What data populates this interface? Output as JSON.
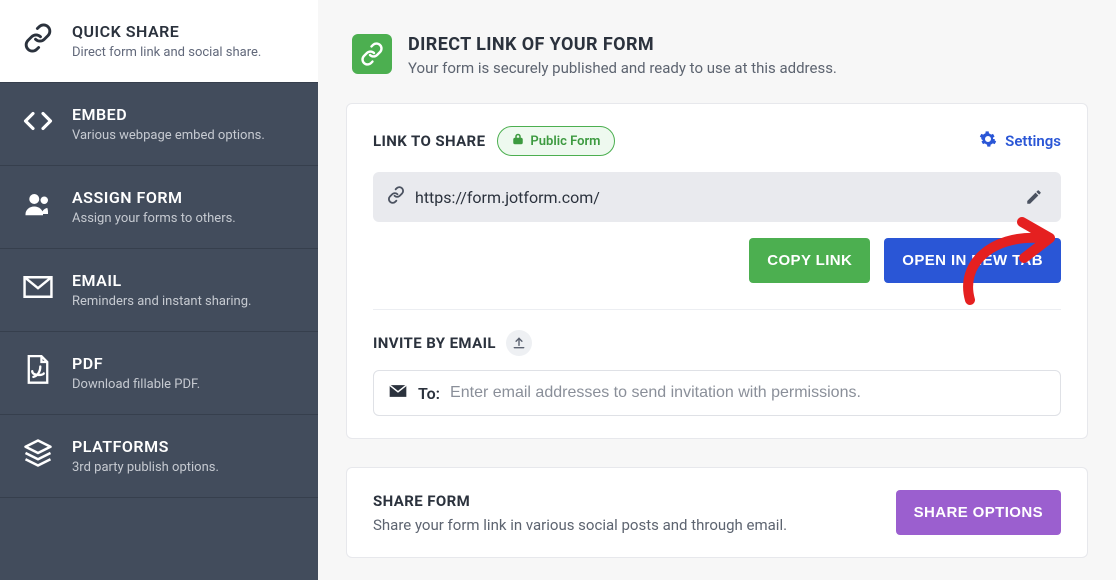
{
  "sidebar": {
    "items": [
      {
        "title": "QUICK SHARE",
        "sub": "Direct form link and social share.",
        "active": true
      },
      {
        "title": "EMBED",
        "sub": "Various webpage embed options."
      },
      {
        "title": "ASSIGN FORM",
        "sub": "Assign your forms to others."
      },
      {
        "title": "EMAIL",
        "sub": "Reminders and instant sharing."
      },
      {
        "title": "PDF",
        "sub": "Download fillable PDF."
      },
      {
        "title": "PLATFORMS",
        "sub": "3rd party publish options."
      }
    ]
  },
  "header": {
    "title": "DIRECT LINK OF YOUR FORM",
    "sub": "Your form is securely published and ready to use at this address."
  },
  "link_section": {
    "label": "LINK TO SHARE",
    "pill": "Public Form",
    "settings": "Settings",
    "url": "https://form.jotform.com/",
    "copy_btn": "COPY LINK",
    "open_btn": "OPEN IN NEW TAB"
  },
  "invite_section": {
    "label": "INVITE BY EMAIL",
    "to_label": "To:",
    "placeholder": "Enter email addresses to send invitation with permissions."
  },
  "share_section": {
    "title": "SHARE FORM",
    "sub": "Share your form link in various social posts and through email.",
    "btn": "SHARE OPTIONS"
  }
}
